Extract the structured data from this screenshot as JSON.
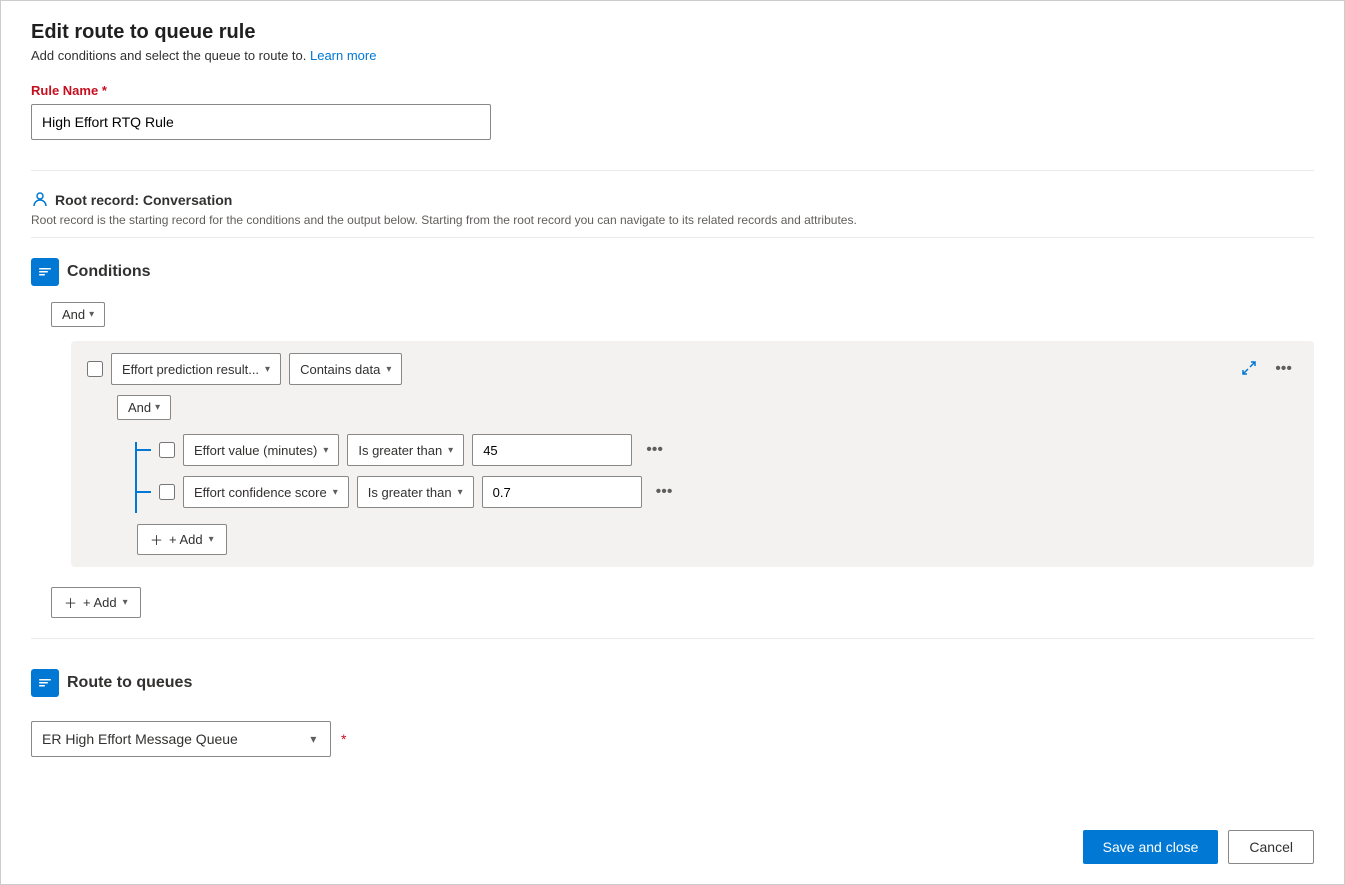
{
  "page": {
    "title": "Edit route to queue rule",
    "subtitle": "Add conditions and select the queue to route to.",
    "learn_more": "Learn more",
    "learn_more_url": "#"
  },
  "rule_name": {
    "label": "Rule Name",
    "required": true,
    "value": "High Effort RTQ Rule"
  },
  "root_record": {
    "label": "Root record:",
    "value": "Conversation",
    "description": "Root record is the starting record for the conditions and the output below. Starting from the root record you can navigate to its related records and attributes."
  },
  "conditions": {
    "section_title": "Conditions",
    "and_label": "And",
    "top_condition": {
      "field": "Effort prediction result...",
      "operator": "Contains data"
    },
    "inner_and_label": "And",
    "inner_conditions": [
      {
        "field": "Effort value (minutes)",
        "operator": "Is greater than",
        "value": "45"
      },
      {
        "field": "Effort confidence score",
        "operator": "Is greater than",
        "value": "0.7"
      }
    ],
    "add_label": "+ Add",
    "outer_add_label": "+ Add"
  },
  "route_to_queues": {
    "section_title": "Route to queues",
    "queue_value": "ER High Effort Message Queue",
    "required": true
  },
  "footer": {
    "save_label": "Save and close",
    "cancel_label": "Cancel"
  }
}
